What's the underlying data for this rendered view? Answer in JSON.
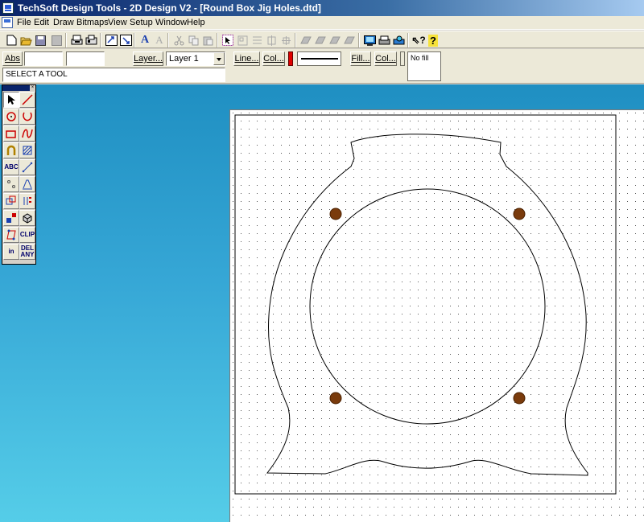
{
  "window": {
    "title": "TechSoft Design Tools - 2D Design V2 - [Round Box Jig Holes.dtd]"
  },
  "menu": [
    "File",
    "Edit",
    "Draw",
    "Bitmaps",
    "View",
    "Setup",
    "Window",
    "Help"
  ],
  "toolbar1": {
    "icons": [
      "new-icon",
      "open-icon",
      "save-icon",
      "print-preview-icon",
      "print-icon",
      "import-icon",
      "export-icon",
      "text-style-icon",
      "text-icon",
      "cut-icon",
      "copy-icon",
      "paste-icon",
      "select-all-icon",
      "group-icon",
      "align-icon",
      "distribute-icon",
      "move-icon",
      "bring-front-icon",
      "send-back-icon",
      "flip-icon",
      "rotate-icon",
      "screen-icon",
      "printer-icon",
      "plotter-icon",
      "context-help-icon",
      "help-icon"
    ]
  },
  "propbar": {
    "abs_label": "Abs",
    "x_value": "",
    "y_value": "",
    "layer_label": "Layer...",
    "layer_value": "Layer 1",
    "line_label": "Line...",
    "line_col_label": "Col...",
    "line_color": "#e00000",
    "fill_label": "Fill...",
    "fill_col_label": "Col...",
    "fill_value": "No fill",
    "status": "SELECT A TOOL"
  },
  "palette": {
    "tools": [
      {
        "name": "select-tool-icon",
        "text": ""
      },
      {
        "name": "line-tool-icon",
        "text": ""
      },
      {
        "name": "circle-tool-icon",
        "text": ""
      },
      {
        "name": "arc-tool-icon",
        "text": ""
      },
      {
        "name": "rectangle-tool-icon",
        "text": ""
      },
      {
        "name": "curve-tool-icon",
        "text": ""
      },
      {
        "name": "fillet-tool-icon",
        "text": ""
      },
      {
        "name": "hatch-tool-icon",
        "text": ""
      },
      {
        "name": "text-tool-icon",
        "text": "ABC"
      },
      {
        "name": "dimension-tool-icon",
        "text": ""
      },
      {
        "name": "point-tool-icon",
        "text": ""
      },
      {
        "name": "transform-tool-icon",
        "text": ""
      },
      {
        "name": "copy-transform-tool-icon",
        "text": ""
      },
      {
        "name": "array-tool-icon",
        "text": ""
      },
      {
        "name": "zoom-tool-icon",
        "text": ""
      },
      {
        "name": "solid-tool-icon",
        "text": ""
      },
      {
        "name": "edit-tool-icon",
        "text": ""
      },
      {
        "name": "clip-tool-icon",
        "text": "CLIP"
      },
      {
        "name": "delete-in-tool-icon",
        "text": "in"
      },
      {
        "name": "delete-any-tool-icon",
        "text": "DEL ANY"
      }
    ]
  },
  "drawing": {
    "hole_color": "#7a3b0c",
    "outline_color": "#000000"
  }
}
